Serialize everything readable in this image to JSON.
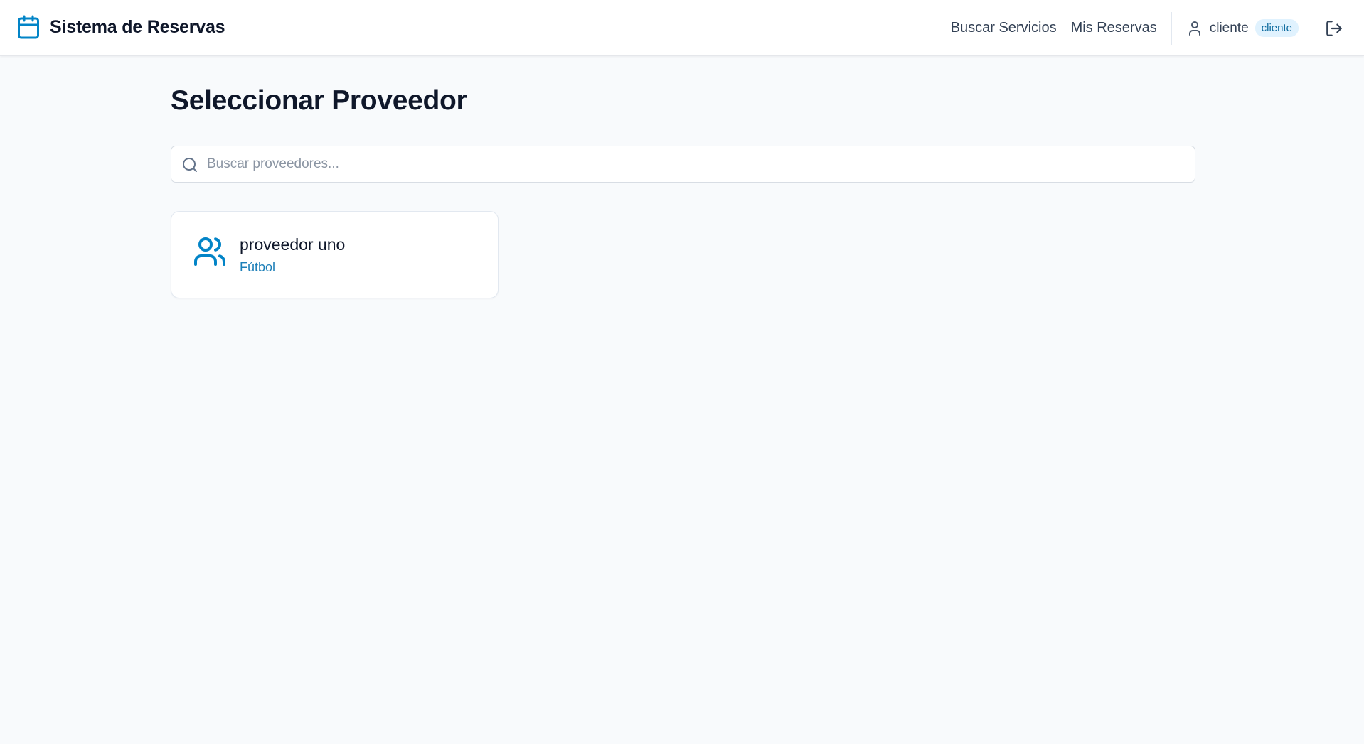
{
  "app": {
    "title": "Sistema de Reservas",
    "brand_icon": "calendar-icon",
    "accent_color": "#0284c7"
  },
  "nav": {
    "links": [
      {
        "label": "Buscar Servicios"
      },
      {
        "label": "Mis Reservas"
      }
    ],
    "user": {
      "icon": "user-icon",
      "name": "cliente",
      "role": "cliente"
    },
    "logout_icon": "logout-icon"
  },
  "main": {
    "title": "Seleccionar Proveedor",
    "search": {
      "placeholder": "Buscar proveedores...",
      "value": "",
      "icon": "search-icon"
    },
    "providers": [
      {
        "icon": "users-icon",
        "name": "proveedor uno",
        "category": "Fútbol"
      }
    ]
  }
}
